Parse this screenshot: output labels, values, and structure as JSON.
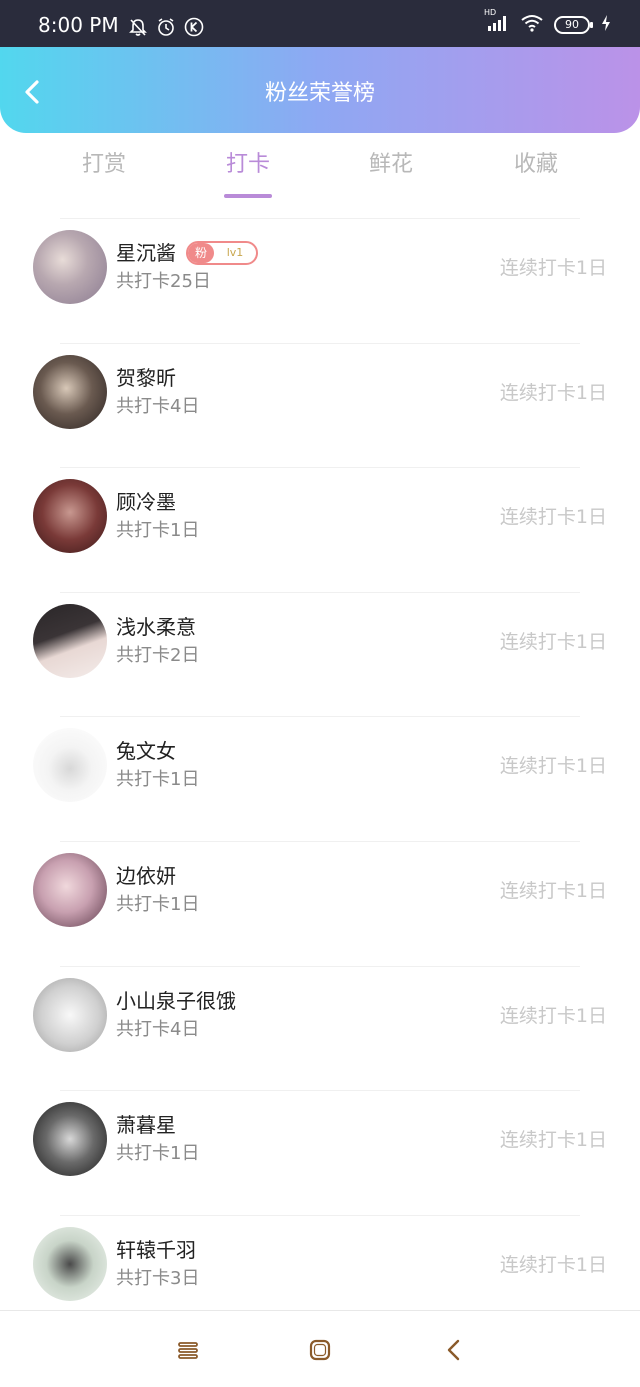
{
  "status_bar": {
    "time": "8:00 PM",
    "hd": "HD",
    "battery": "90",
    "icons": [
      "bell-off-icon",
      "alarm-icon",
      "k-circle-icon",
      "signal-icon",
      "wifi-icon",
      "battery-icon",
      "charging-icon"
    ]
  },
  "header": {
    "title": "粉丝荣誉榜",
    "back_icon": "chevron-left-icon"
  },
  "tabs": [
    {
      "label": "打赏",
      "active": false
    },
    {
      "label": "打卡",
      "active": true
    },
    {
      "label": "鲜花",
      "active": false
    },
    {
      "label": "收藏",
      "active": false
    }
  ],
  "fans": [
    {
      "name": "星沉酱",
      "total": "共打卡25日",
      "streak": "连续打卡1日",
      "badge": {
        "fan": "粉",
        "level": "lv1"
      }
    },
    {
      "name": "贺黎昕",
      "total": "共打卡4日",
      "streak": "连续打卡1日"
    },
    {
      "name": "顾冷墨",
      "total": "共打卡1日",
      "streak": "连续打卡1日"
    },
    {
      "name": "浅水柔意",
      "total": "共打卡2日",
      "streak": "连续打卡1日"
    },
    {
      "name": "兔文女",
      "total": "共打卡1日",
      "streak": "连续打卡1日"
    },
    {
      "name": "边依妍",
      "total": "共打卡1日",
      "streak": "连续打卡1日"
    },
    {
      "name": "小山泉子很饿",
      "total": "共打卡4日",
      "streak": "连续打卡1日"
    },
    {
      "name": "萧暮星",
      "total": "共打卡1日",
      "streak": "连续打卡1日"
    },
    {
      "name": "轩辕千羽",
      "total": "共打卡3日",
      "streak": "连续打卡1日"
    }
  ],
  "nav": [
    "menu-icon",
    "home-square-icon",
    "back-chevron-icon"
  ],
  "colors": {
    "accent": "#b98bd8",
    "header_start": "#52d7ee",
    "header_end": "#bb92e8",
    "badge": "#f08a8a"
  }
}
